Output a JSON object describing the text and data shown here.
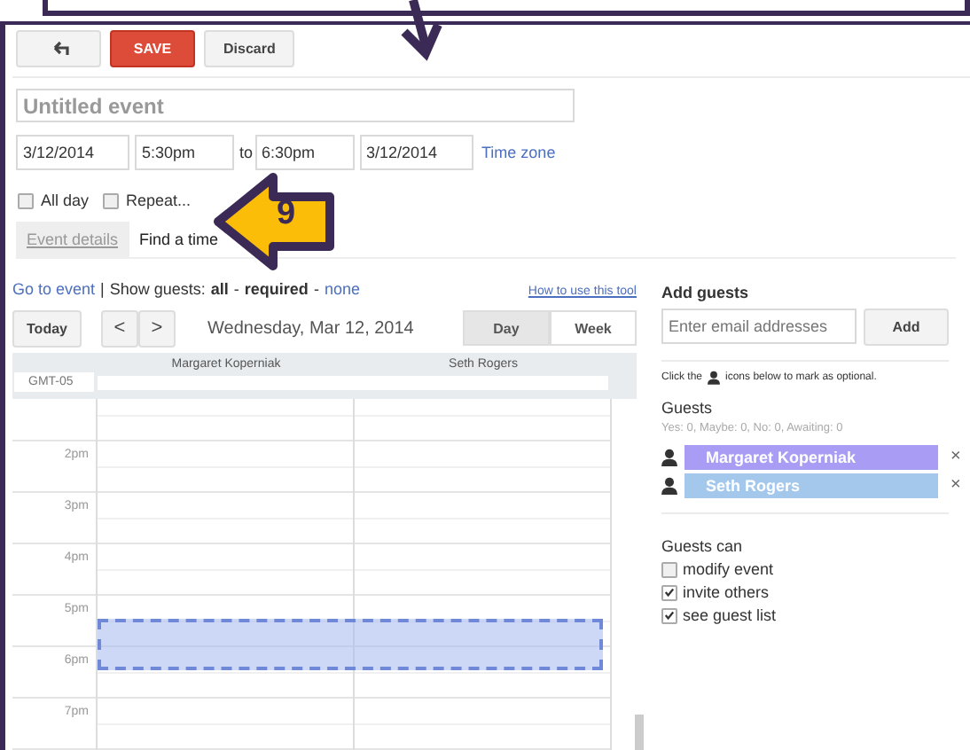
{
  "toolbar": {
    "buttons": [
      {
        "kind": "back"
      },
      {
        "kind": "primary",
        "label": "SAVE"
      },
      {
        "kind": "plain",
        "label": "Discard"
      }
    ]
  },
  "event": {
    "title": {
      "placeholder": "Untitled event"
    },
    "start_date": "3/12/2014",
    "start_time": "5:30pm",
    "separator": "to",
    "end_time": "6:30pm",
    "end_date": "3/12/2014",
    "time_zone_link": "Time zone"
  },
  "options": [
    {
      "label": "All day",
      "checked": false
    },
    {
      "label": "Repeat...",
      "checked": false
    }
  ],
  "tabs": [
    {
      "label": "Event details",
      "selected": false
    },
    {
      "label": "Find a time",
      "selected": true
    }
  ],
  "finder": {
    "go_to_event": "Go to event",
    "divider": "|",
    "show_guests_label": "Show guests:",
    "filters": [
      {
        "label": "all",
        "selected": true
      },
      {
        "label": "-",
        "kind": "sep"
      },
      {
        "label": "required",
        "selected": true
      },
      {
        "label": "-",
        "kind": "sep"
      },
      {
        "label": "none",
        "selected": false
      }
    ],
    "help_link": "How to use this tool",
    "today": "Today",
    "prev": "<",
    "next": ">",
    "date": "Wednesday, Mar 12, 2014",
    "views": [
      {
        "label": "Day",
        "selected": true
      },
      {
        "label": "Week",
        "selected": false
      }
    ],
    "timezone": "GMT-05",
    "columns": [
      "Margaret Koperniak",
      "Seth Rogers"
    ],
    "hours": [
      "2pm",
      "3pm",
      "4pm",
      "5pm",
      "6pm",
      "7pm"
    ]
  },
  "guests_panel": {
    "add_title": "Add guests",
    "email": {
      "placeholder": "Enter email addresses"
    },
    "add_button": "Add",
    "hint_before": "Click the",
    "hint_after": "icons below to mark as optional.",
    "guests_title": "Guests",
    "summary": "Yes: 0, Maybe: 0, No: 0, Awaiting: 0",
    "guests": [
      {
        "name": "Margaret Koperniak",
        "color": "#a99cf4"
      },
      {
        "name": "Seth Rogers",
        "color": "#a3c8ec"
      }
    ],
    "remove": "×",
    "permissions_title": "Guests can",
    "permissions": [
      {
        "label": "modify event",
        "checked": false
      },
      {
        "label": "invite others",
        "checked": true
      },
      {
        "label": "see guest list",
        "checked": true
      }
    ]
  },
  "callout": {
    "number": "9"
  }
}
